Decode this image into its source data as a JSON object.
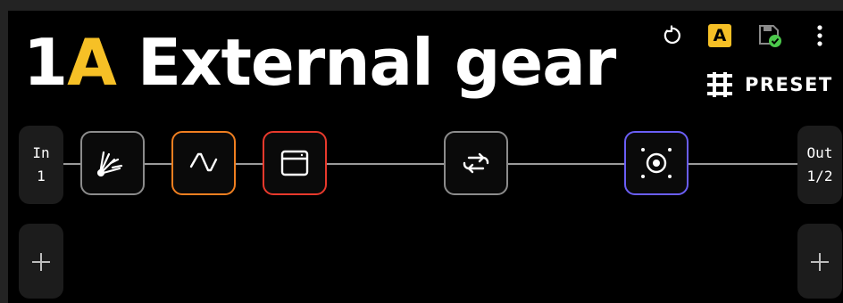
{
  "preset": {
    "number": "1",
    "bank": "A",
    "name": "External gear"
  },
  "toolbar": {
    "bank_badge": "A",
    "preset_label": "PRESET"
  },
  "signal_chain": {
    "input": {
      "label": "In",
      "value": "1"
    },
    "output": {
      "label": "Out",
      "value": "1/2"
    },
    "blocks": [
      {
        "icon": "wah-icon",
        "color": "#8c8c8c"
      },
      {
        "icon": "filter-icon",
        "color": "#f07f20"
      },
      {
        "icon": "amp-icon",
        "color": "#e8392c"
      },
      {
        "icon": "loop-icon",
        "color": "#8c8c8c"
      },
      {
        "icon": "speaker-icon",
        "color": "#6a5ef5"
      }
    ]
  },
  "colors": {
    "bank_accent": "#f6c026",
    "saved_status": "#4cc94c"
  }
}
